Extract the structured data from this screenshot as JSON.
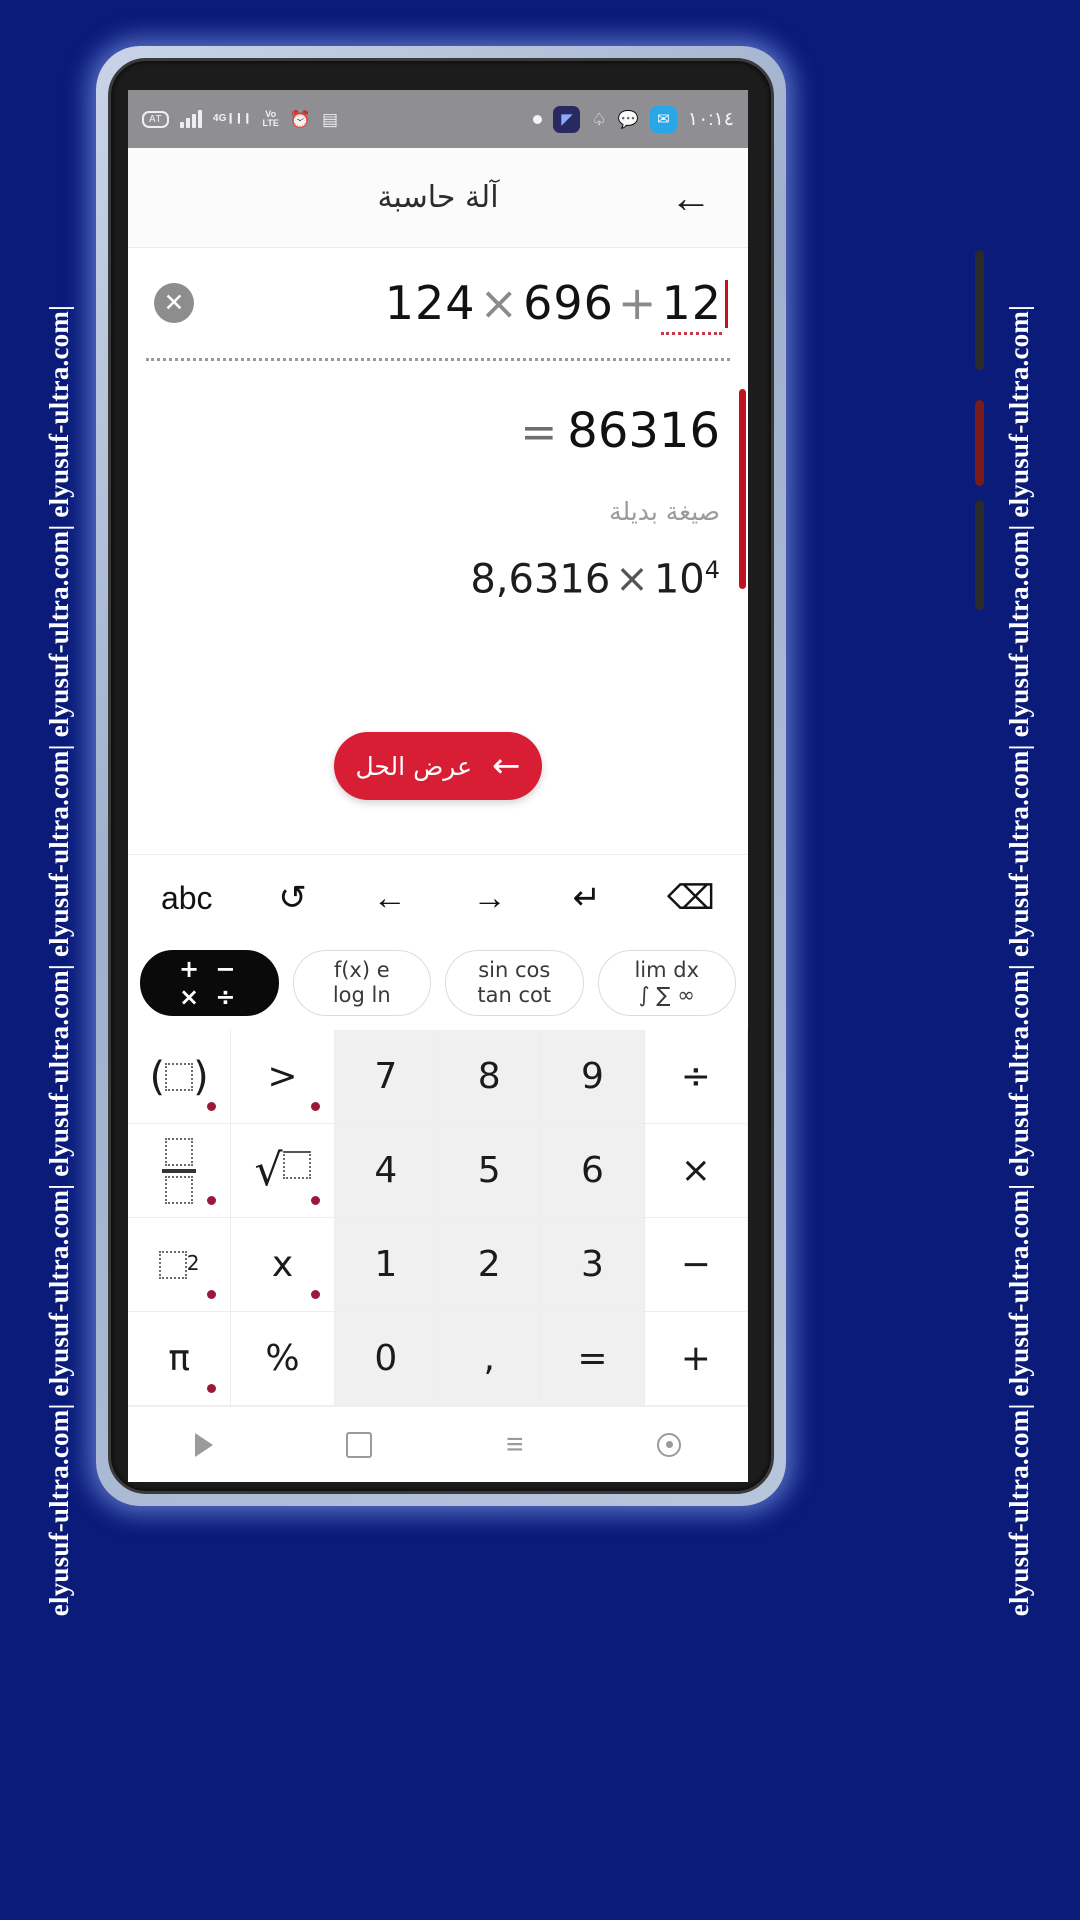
{
  "watermark": {
    "text": "elyusuf-ultra.com| elyusuf-ultra.com| elyusuf-ultra.com| elyusuf-ultra.com| elyusuf-ultra.com| elyusuf-ultra.com|",
    "color": "#ffffff",
    "background": "#0a1b7a"
  },
  "status_bar": {
    "time": "١٠:١٤",
    "left_icons": [
      "sim-card-icon",
      "signal-bars-icon",
      "4g-signal-icon",
      "volte-icon",
      "alarm-clock-icon",
      "sms-muted-icon"
    ],
    "right_icons": [
      "white-dot-icon",
      "app-badge-icon",
      "bell-icon",
      "chat-bubble-icon",
      "mail-icon"
    ],
    "labels": {
      "sim": "AT",
      "g4": "4G",
      "volte_top": "Vo",
      "volte_bottom": "LTE"
    },
    "background": "#8f8f93"
  },
  "app_bar": {
    "title": "آلة حاسبة",
    "back_icon": "back-arrow-icon"
  },
  "display": {
    "clear_icon": "clear-circle-x-icon",
    "expression": "124×696+12",
    "expr_parts": {
      "a": "124",
      "mul": "×",
      "b": "696",
      "plus": "+",
      "c": "12"
    },
    "caret_color": "#c1121f",
    "result_equals": "=",
    "result_value": "86316",
    "alt_label": "صيغة بديلة",
    "alt_mantissa": "8,6316",
    "alt_times": "×",
    "alt_base": "10",
    "alt_exponent": "4",
    "scrollbar_color": "#c1121f"
  },
  "cta": {
    "label": "عرض الحل",
    "arrow_icon": "arrow-left-icon",
    "color": "#d81e34"
  },
  "keyboard_toolbar": [
    {
      "name": "abc-key",
      "label": "abc",
      "icon": "abc-text-icon"
    },
    {
      "name": "history-key",
      "label": "↺",
      "icon": "history-clock-icon"
    },
    {
      "name": "cursor-left-key",
      "label": "←",
      "icon": "arrow-left-icon"
    },
    {
      "name": "cursor-right-key",
      "label": "→",
      "icon": "arrow-right-icon"
    },
    {
      "name": "enter-key",
      "label": "↵",
      "icon": "enter-return-icon"
    },
    {
      "name": "backspace-key",
      "label": "⌫",
      "icon": "backspace-icon"
    }
  ],
  "mode_tabs": [
    {
      "name": "tab-arithmetic",
      "line1": "+ −",
      "line2": "× ÷",
      "active": true
    },
    {
      "name": "tab-functions",
      "line1": "f(x)  e",
      "line2": "log  ln",
      "active": false
    },
    {
      "name": "tab-trig",
      "line1": "sin cos",
      "line2": "tan cot",
      "active": false
    },
    {
      "name": "tab-calculus",
      "line1": "lim  dx",
      "line2": "∫ ∑ ∞",
      "active": false
    }
  ],
  "keypad": {
    "rows": [
      [
        {
          "name": "key-parentheses",
          "type": "func",
          "glyph": "( ▫ )",
          "dot": true
        },
        {
          "name": "key-greater-than",
          "type": "func",
          "glyph": ">",
          "dot": true
        },
        {
          "name": "key-7",
          "type": "num",
          "glyph": "7",
          "dot": false
        },
        {
          "name": "key-8",
          "type": "num",
          "glyph": "8",
          "dot": false
        },
        {
          "name": "key-9",
          "type": "num",
          "glyph": "9",
          "dot": false
        },
        {
          "name": "key-divide",
          "type": "op",
          "glyph": "÷",
          "dot": false
        }
      ],
      [
        {
          "name": "key-fraction",
          "type": "func",
          "glyph": "▫/▫",
          "dot": true
        },
        {
          "name": "key-square-root",
          "type": "func",
          "glyph": "√▫",
          "dot": true
        },
        {
          "name": "key-4",
          "type": "num",
          "glyph": "4",
          "dot": false
        },
        {
          "name": "key-5",
          "type": "num",
          "glyph": "5",
          "dot": false
        },
        {
          "name": "key-6",
          "type": "num",
          "glyph": "6",
          "dot": false
        },
        {
          "name": "key-multiply",
          "type": "op",
          "glyph": "×",
          "dot": false
        }
      ],
      [
        {
          "name": "key-power",
          "type": "func",
          "glyph": "▫²",
          "dot": true
        },
        {
          "name": "key-variable-x",
          "type": "func",
          "glyph": "x",
          "dot": true
        },
        {
          "name": "key-1",
          "type": "num",
          "glyph": "1",
          "dot": false
        },
        {
          "name": "key-2",
          "type": "num",
          "glyph": "2",
          "dot": false
        },
        {
          "name": "key-3",
          "type": "num",
          "glyph": "3",
          "dot": false
        },
        {
          "name": "key-minus",
          "type": "op",
          "glyph": "−",
          "dot": false
        }
      ],
      [
        {
          "name": "key-pi",
          "type": "func",
          "glyph": "π",
          "dot": true
        },
        {
          "name": "key-percent",
          "type": "func",
          "glyph": "%",
          "dot": false
        },
        {
          "name": "key-0",
          "type": "num",
          "glyph": "0",
          "dot": false
        },
        {
          "name": "key-comma",
          "type": "num",
          "glyph": ",",
          "dot": false
        },
        {
          "name": "key-equals",
          "type": "num",
          "glyph": "=",
          "dot": false
        },
        {
          "name": "key-plus",
          "type": "op",
          "glyph": "+",
          "dot": false
        }
      ]
    ]
  },
  "nav_bar": {
    "items": [
      {
        "name": "nav-back-icon",
        "glyph": "▷"
      },
      {
        "name": "nav-home-icon",
        "glyph": "□"
      },
      {
        "name": "nav-recents-icon",
        "glyph": "≡"
      },
      {
        "name": "nav-assistant-icon",
        "glyph": "⊙"
      }
    ]
  }
}
